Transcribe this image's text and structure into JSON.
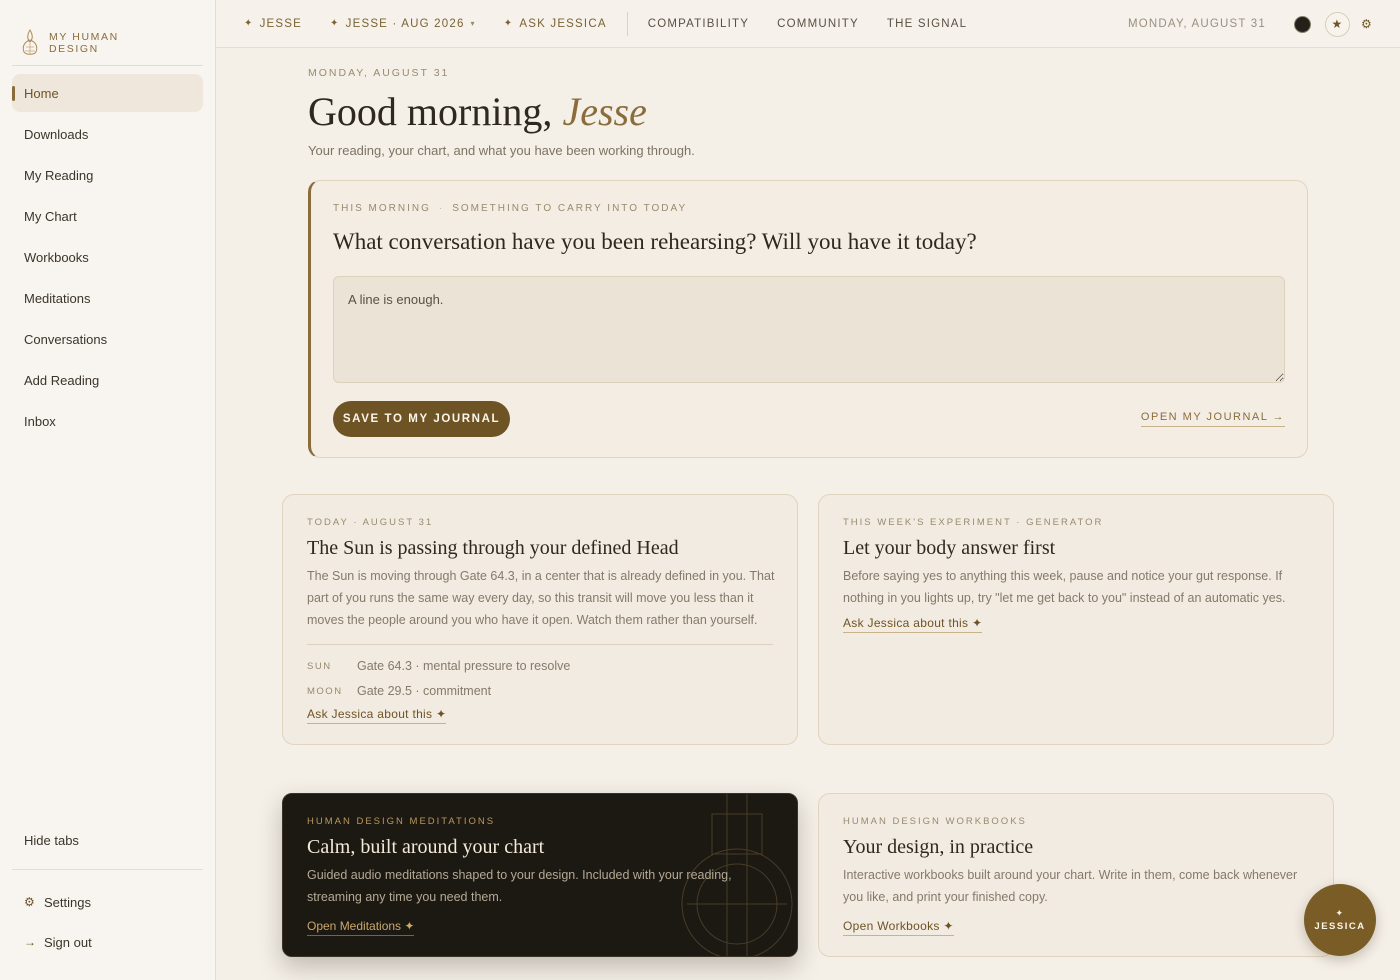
{
  "brand": {
    "line1": "My Human",
    "line2": "Design",
    "icon": "lotus-logo-icon"
  },
  "sidebar": {
    "items": [
      {
        "label": "Home",
        "active": true
      },
      {
        "label": "Downloads"
      },
      {
        "label": "My Reading"
      },
      {
        "label": "My Chart"
      },
      {
        "label": "Workbooks"
      },
      {
        "label": "Meditations"
      },
      {
        "label": "Conversations"
      },
      {
        "label": "Add Reading"
      },
      {
        "label": "Inbox"
      }
    ],
    "hide_tabs": "Hide tabs",
    "settings": "Settings",
    "settings_icon": "⚙",
    "sign_out": "Sign out",
    "sign_out_icon": "→"
  },
  "topbar": {
    "jesse": "Jesse",
    "jesse_period": "Jesse · Aug 2026",
    "ask_jessica": "Ask Jessica",
    "compatibility": "Compatibility",
    "community": "Community",
    "signal": "The Signal",
    "date": "Monday, August 31",
    "star_glyph": "✦",
    "caret_glyph": "▾",
    "favorite_glyph": "★",
    "settings_glyph": "⚙"
  },
  "main": {
    "date_kicker": "Monday, August 31",
    "greeting_prefix": "Good morning,",
    "greeting_name": "Jesse",
    "subtitle": "Your reading, your chart, and what you have been working through."
  },
  "journal": {
    "kicker_a": "This morning",
    "kicker_sep": "·",
    "kicker_b": "Something to carry into today",
    "question": "What conversation have you been rehearsing? Will you have it today?",
    "placeholder": "A line is enough.",
    "save_label": "Save to my journal",
    "open_label": "Open my journal →"
  },
  "transit_card": {
    "kicker": "Today · August 31",
    "title": "The Sun is passing through your defined Head",
    "body": "The Sun is moving through Gate 64.3, in a center that is already defined in you. That part of you runs the same way every day, so this transit will move you less than it moves the people around you who have it open. Watch them rather than yourself.",
    "rows": [
      {
        "label": "Sun",
        "value": "Gate 64.3 · mental pressure to resolve"
      },
      {
        "label": "Moon",
        "value": "Gate 29.5 · commitment"
      }
    ],
    "link": "Ask Jessica about this ✦"
  },
  "experiment_card": {
    "kicker": "This week's experiment · Generator",
    "title": "Let your body answer first",
    "body": "Before saying yes to anything this week, pause and notice your gut response. If nothing in you lights up, try \"let me get back to you\" instead of an automatic yes.",
    "link": "Ask Jessica about this ✦"
  },
  "meditations_card": {
    "kicker": "Human Design Meditations",
    "title": "Calm, built around your chart",
    "body": "Guided audio meditations shaped to your design. Included with your reading, streaming any time you need them.",
    "link": "Open Meditations ✦"
  },
  "workbooks_card": {
    "kicker": "Human Design Workbooks",
    "title": "Your design, in practice",
    "body": "Interactive workbooks built around your chart. Write in them, come back whenever you like, and print your finished copy.",
    "link": "Open Workbooks ✦"
  },
  "fab": {
    "star": "✦",
    "label": "JESSICA"
  },
  "colors": {
    "accent": "#8a6d3b",
    "accent_dark": "#6e5424",
    "background": "#f4efe7",
    "dark_card": "#1c1812"
  }
}
